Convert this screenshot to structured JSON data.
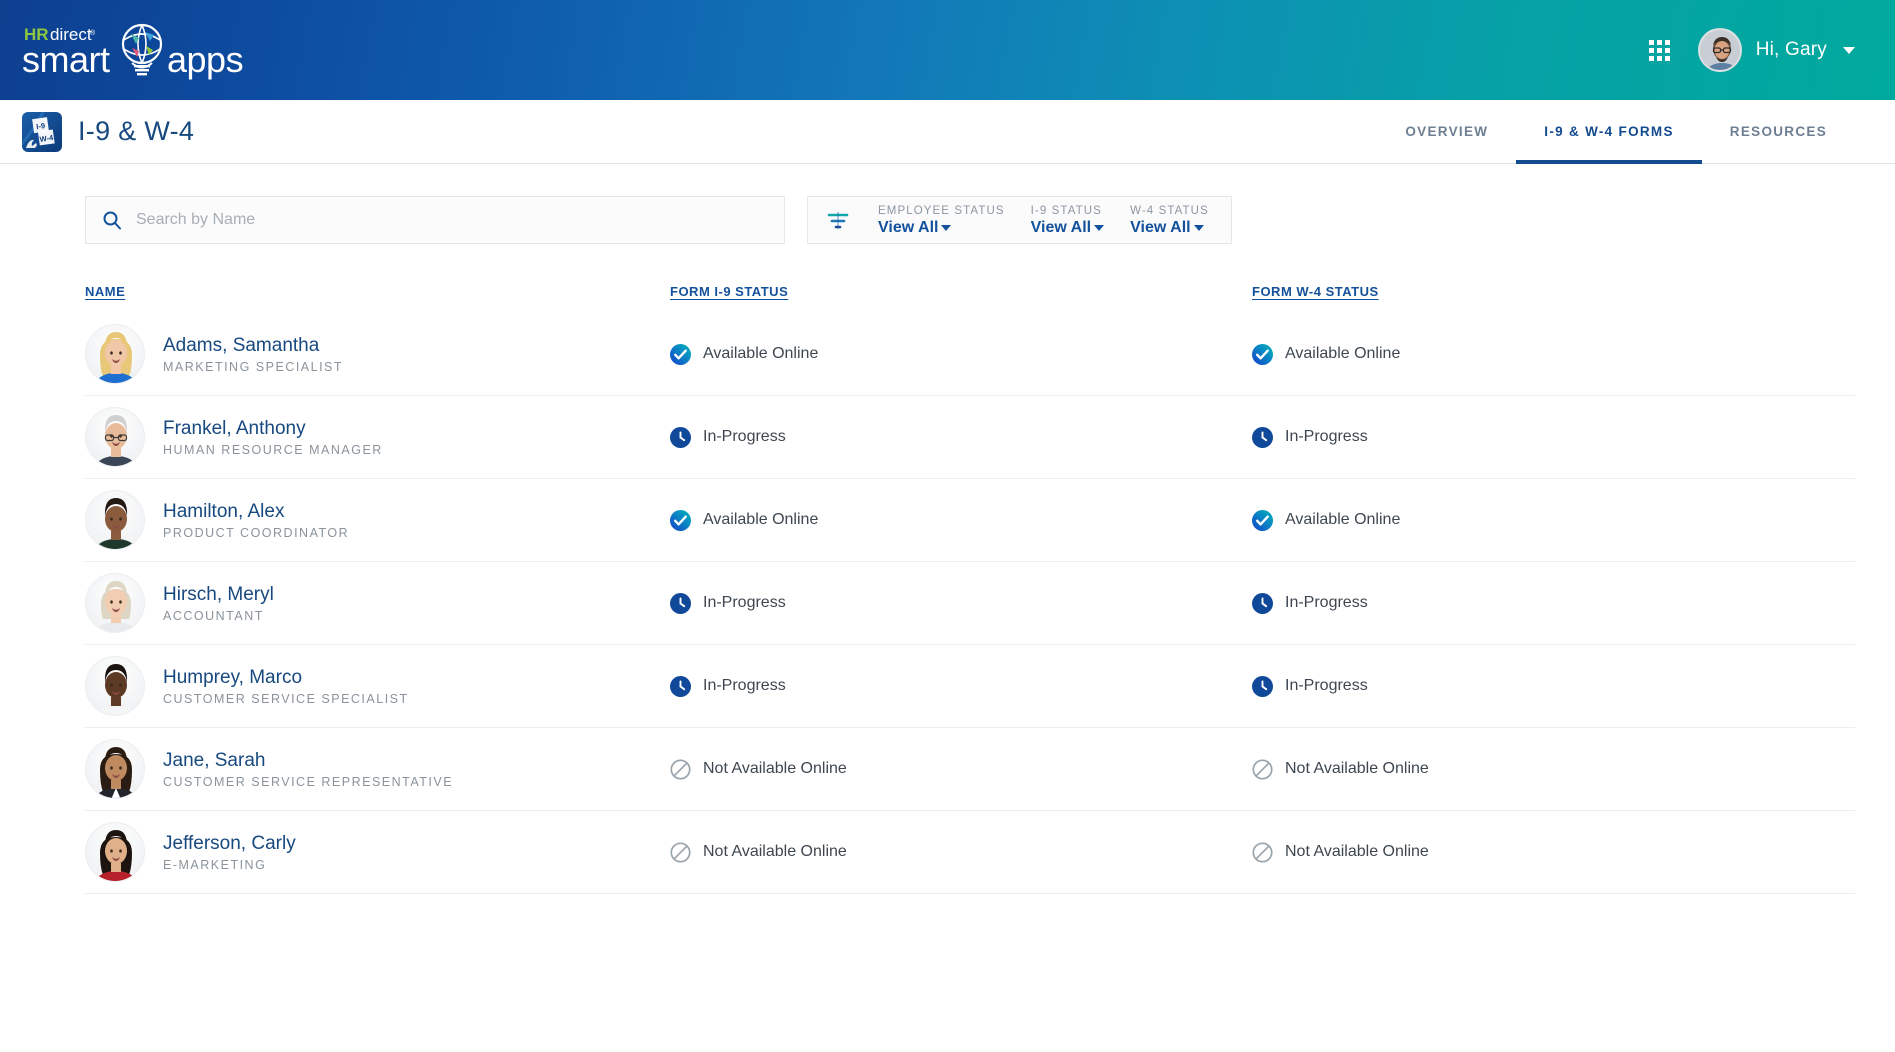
{
  "header": {
    "logo": {
      "brand_top": "HRdirect",
      "brand_bottom_left": "smart",
      "brand_bottom_right": "apps",
      "icon": "lightbulb-globe-icon"
    },
    "apps_grid_icon": "grid-apps-icon",
    "avatar_icon": "user-avatar",
    "greeting": "Hi, Gary",
    "caret_icon": "chevron-down-icon",
    "gradient_start": "#0d3f8f",
    "gradient_end": "#00a99d"
  },
  "appnav": {
    "app_icon": "i9-w4-forms-icon",
    "app_icon_label_top": "I-9",
    "app_icon_label_bottom": "W-4",
    "title": "I-9 & W-4",
    "tabs": [
      {
        "label": "OVERVIEW",
        "active": false
      },
      {
        "label": "I-9 & W-4 FORMS",
        "active": true
      },
      {
        "label": "RESOURCES",
        "active": false
      }
    ],
    "active_color": "#134b8f"
  },
  "search": {
    "icon": "search-icon",
    "placeholder": "Search by Name",
    "value": ""
  },
  "filters": {
    "icon": "filter-icon",
    "groups": [
      {
        "label": "EMPLOYEE STATUS",
        "value": "View All"
      },
      {
        "label": "I-9 STATUS",
        "value": "View All"
      },
      {
        "label": "W-4 STATUS",
        "value": "View All"
      }
    ]
  },
  "table": {
    "columns": [
      {
        "key": "name",
        "label": "NAME"
      },
      {
        "key": "i9",
        "label": "FORM I-9 STATUS"
      },
      {
        "key": "w4",
        "label": "FORM W-4 STATUS"
      }
    ],
    "rows": [
      {
        "name": "Adams, Samantha",
        "title": "MARKETING SPECIALIST",
        "avatar": "avatar-blonde-woman-blue-top",
        "i9_status": "Available Online",
        "i9_icon": "check-circle-icon",
        "w4_status": "Available Online",
        "w4_icon": "check-circle-icon"
      },
      {
        "name": "Frankel, Anthony",
        "title": "HUMAN RESOURCE MANAGER",
        "avatar": "avatar-older-man-glasses",
        "i9_status": "In-Progress",
        "i9_icon": "clock-icon",
        "w4_status": "In-Progress",
        "w4_icon": "clock-icon"
      },
      {
        "name": "Hamilton, Alex",
        "title": "PRODUCT COORDINATOR",
        "avatar": "avatar-man-dark-polo",
        "i9_status": "Available Online",
        "i9_icon": "check-circle-icon",
        "w4_status": "Available Online",
        "w4_icon": "check-circle-icon"
      },
      {
        "name": "Hirsch, Meryl",
        "title": "ACCOUNTANT",
        "avatar": "avatar-older-woman-blonde",
        "i9_status": "In-Progress",
        "i9_icon": "clock-icon",
        "w4_status": "In-Progress",
        "w4_icon": "clock-icon"
      },
      {
        "name": "Humprey, Marco",
        "title": "CUSTOMER SERVICE SPECIALIST",
        "avatar": "avatar-person-white-top",
        "i9_status": "In-Progress",
        "i9_icon": "clock-icon",
        "w4_status": "In-Progress",
        "w4_icon": "clock-icon"
      },
      {
        "name": "Jane, Sarah",
        "title": "CUSTOMER SERVICE REPRESENTATIVE",
        "avatar": "avatar-woman-black-blazer",
        "i9_status": "Not Available Online",
        "i9_icon": "no-entry-icon",
        "w4_status": "Not Available Online",
        "w4_icon": "no-entry-icon"
      },
      {
        "name": "Jefferson, Carly",
        "title": "E-MARKETING",
        "avatar": "avatar-woman-dark-hair-red",
        "i9_status": "Not Available Online",
        "i9_icon": "no-entry-icon",
        "w4_status": "Not Available Online",
        "w4_icon": "no-entry-icon"
      }
    ]
  },
  "colors": {
    "link_blue": "#13529b",
    "name_blue": "#17497f",
    "muted_gray": "#8a939c",
    "check_teal": "#00b0b9",
    "check_blue": "#1450c8",
    "clock_blue": "#11499a",
    "disabled_gray": "#9aa4ac"
  }
}
